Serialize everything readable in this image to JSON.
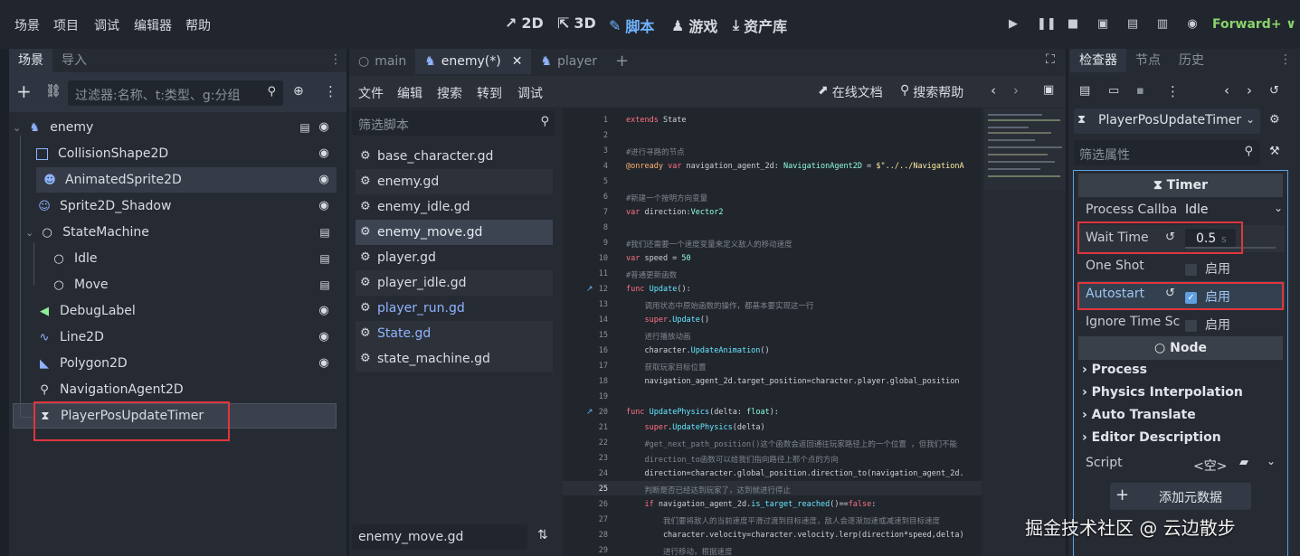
{
  "menu": [
    "场景",
    "项目",
    "调试",
    "编辑器",
    "帮助"
  ],
  "modes": [
    {
      "icon": "2d-icon",
      "label": "2D"
    },
    {
      "icon": "3d-icon",
      "label": "3D"
    },
    {
      "icon": "script-icon",
      "label": "脚本"
    },
    {
      "icon": "game-icon",
      "label": "游戏"
    },
    {
      "icon": "assetlib-icon",
      "label": "资产库"
    }
  ],
  "renderer": "Forward+ ∨",
  "scene_panel": {
    "tabs": [
      "场景",
      "导入"
    ],
    "filter_placeholder": "过滤器:名称、t:类型、g:分组",
    "nodes": [
      {
        "label": "enemy",
        "icon": "enemy-node-icon"
      },
      {
        "label": "CollisionShape2D"
      },
      {
        "label": "AnimatedSprite2D"
      },
      {
        "label": "Sprite2D_Shadow"
      },
      {
        "label": "StateMachine"
      },
      {
        "label": "Idle"
      },
      {
        "label": "Move"
      },
      {
        "label": "DebugLabel"
      },
      {
        "label": "Line2D"
      },
      {
        "label": "Polygon2D"
      },
      {
        "label": "NavigationAgent2D"
      },
      {
        "label": "PlayerPosUpdateTimer"
      }
    ]
  },
  "editor_tabs": [
    {
      "label": "main"
    },
    {
      "label": "enemy(*)"
    },
    {
      "label": "player"
    }
  ],
  "script_menu": [
    "文件",
    "编辑",
    "搜索",
    "转到",
    "调试"
  ],
  "online_docs": "在线文档",
  "search_help": "搜索帮助",
  "script_filter_placeholder": "筛选脚本",
  "scripts": [
    "base_character.gd",
    "enemy.gd",
    "enemy_idle.gd",
    "enemy_move.gd",
    "player.gd",
    "player_idle.gd",
    "player_run.gd",
    "State.gd",
    "state_machine.gd"
  ],
  "current_script": "enemy_move.gd",
  "code_lines": [
    {
      "n": "1",
      "t": "extends State"
    },
    {
      "n": "2",
      "t": ""
    },
    {
      "n": "3",
      "t": "#进行寻路的节点"
    },
    {
      "n": "4",
      "t": "@onready var navigation_agent_2d: NavigationAgent2D = $\"../../NavigationA"
    },
    {
      "n": "5",
      "t": ""
    },
    {
      "n": "6",
      "t": "#新建一个按明方向变量"
    },
    {
      "n": "7",
      "t": "var direction:Vector2"
    },
    {
      "n": "8",
      "t": ""
    },
    {
      "n": "9",
      "t": "#我们还需要一个速度变量来定义敌人的移动速度"
    },
    {
      "n": "10",
      "t": "var speed = 50"
    },
    {
      "n": "11",
      "t": "#普通更新函数"
    },
    {
      "n": "12",
      "t": "func Update():"
    },
    {
      "n": "13",
      "t": "    调用状态中原始函数的操作，都基本要实现这一行"
    },
    {
      "n": "14",
      "t": "    super.Update()"
    },
    {
      "n": "15",
      "t": "    进行播放动画"
    },
    {
      "n": "16",
      "t": "    character.UpdateAnimation()"
    },
    {
      "n": "17",
      "t": "    获取玩家目标位置"
    },
    {
      "n": "18",
      "t": "    navigation_agent_2d.target_position=character.player.global_position"
    },
    {
      "n": "19",
      "t": ""
    },
    {
      "n": "20",
      "t": "func UpdatePhysics(delta: float):"
    },
    {
      "n": "21",
      "t": "    super.UpdatePhysics(delta)"
    },
    {
      "n": "22",
      "t": "    #get_next_path_position()这个函数会返回通往玩家路径上的一个位置 ，但我们不能"
    },
    {
      "n": "23",
      "t": "    direction_to函数可以给我们指向路径上那个点的方向"
    },
    {
      "n": "24",
      "t": "    direction=character.global_position.direction_to(navigation_agent_2d."
    },
    {
      "n": "25",
      "t": "    判断是否已经达到玩家了，达到就进行停止"
    },
    {
      "n": "26",
      "t": "    if navigation_agent_2d.is_target_reached()==false:"
    },
    {
      "n": "27",
      "t": "        我们要将敌人的当前速度平滑过渡到目标速度，敌人会逐渐加速或减速到目标速度"
    },
    {
      "n": "28",
      "t": "        character.velocity=character.velocity.lerp(direction*speed,delta)"
    },
    {
      "n": "29",
      "t": "        进行移动，根据速度"
    }
  ],
  "inspector": {
    "tabs": [
      "检查器",
      "节点",
      "历史"
    ],
    "object": "PlayerPosUpdateTimer",
    "filter_placeholder": "筛选属性",
    "timer_section": "Timer",
    "process_callback_label": "Process Callba",
    "process_callback_value": "Idle",
    "wait_time_label": "Wait Time",
    "wait_time_value": "0.5",
    "wait_time_unit": "s",
    "one_shot_label": "One Shot",
    "autostart_label": "Autostart",
    "ignore_time_scale_label": "Ignore Time Sc",
    "enable_label": "启用",
    "node_section": "Node",
    "categories": [
      "Process",
      "Physics Interpolation",
      "Auto Translate",
      "Editor Description"
    ],
    "script_label": "Script",
    "script_value": "<空>",
    "add_metadata": "添加元数据"
  },
  "watermark": "掘金技术社区 @ 云边散步"
}
